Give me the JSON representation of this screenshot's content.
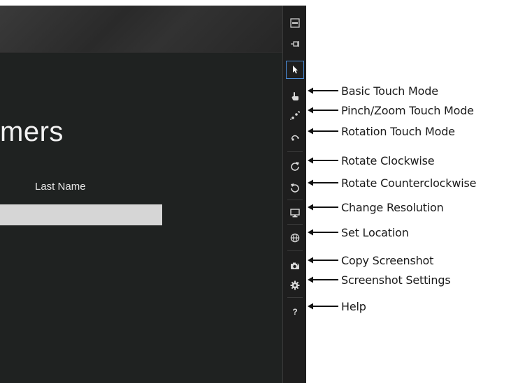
{
  "app": {
    "page_title": "mers",
    "last_name_label": "Last Name",
    "last_name_value": ""
  },
  "toolbar": {
    "buttons": [
      {
        "icon": "minimize-icon"
      },
      {
        "icon": "pin-icon"
      },
      {
        "icon": "mouse-pointer-icon",
        "selected": true
      },
      {
        "icon": "touch-hand-icon"
      },
      {
        "icon": "pinch-zoom-icon"
      },
      {
        "icon": "rotation-touch-icon"
      },
      {
        "icon": "rotate-clockwise-icon"
      },
      {
        "icon": "rotate-counterclockwise-icon"
      },
      {
        "icon": "monitor-icon"
      },
      {
        "icon": "globe-icon"
      },
      {
        "icon": "camera-icon"
      },
      {
        "icon": "gear-icon"
      },
      {
        "icon": "question-icon"
      }
    ]
  },
  "callouts": [
    "Basic Touch Mode",
    "Pinch/Zoom Touch Mode",
    "Rotation Touch Mode",
    "Rotate Clockwise",
    "Rotate Counterclockwise",
    "Change Resolution",
    "Set Location",
    "Copy Screenshot",
    "Screenshot Settings",
    "Help"
  ],
  "help_glyph": "?",
  "colors": {
    "app_background": "#1f2221",
    "toolbar_background": "#1e1e1e",
    "selection_accent": "#4a8bd6",
    "input_background": "#d6d6d6"
  }
}
